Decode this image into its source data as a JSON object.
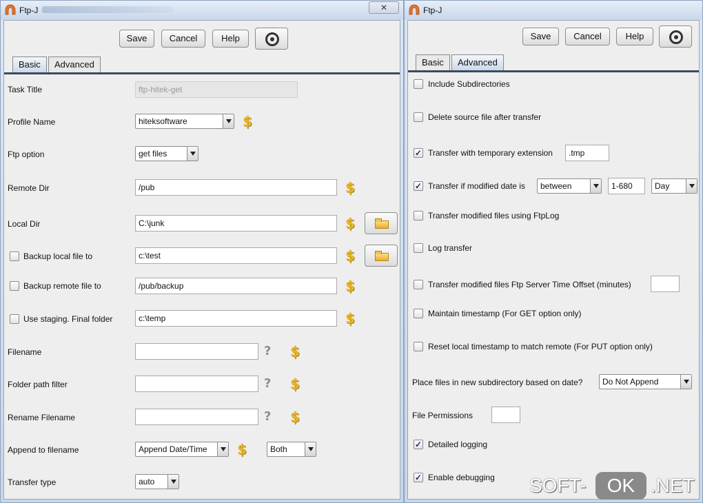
{
  "left_window": {
    "title": "Ftp-J",
    "close_glyph": "✕",
    "toolbar": {
      "save": "Save",
      "cancel": "Cancel",
      "help": "Help"
    },
    "tabs": {
      "basic": "Basic",
      "advanced": "Advanced",
      "active": "Basic"
    },
    "fields": {
      "task_title": {
        "label": "Task Title",
        "value": "ftp-hitek-get"
      },
      "profile_name": {
        "label": "Profile Name",
        "value": "hiteksoftware"
      },
      "ftp_option": {
        "label": "Ftp option",
        "value": "get files"
      },
      "remote_dir": {
        "label": "Remote Dir",
        "value": "/pub"
      },
      "local_dir": {
        "label": "Local Dir",
        "value": "C:\\junk"
      },
      "backup_local": {
        "label": "Backup local file to",
        "value": "c:\\test",
        "checked": false
      },
      "backup_remote": {
        "label": "Backup remote file to",
        "value": "/pub/backup",
        "checked": false
      },
      "staging": {
        "label": "Use staging.  Final folder",
        "value": "c:\\temp",
        "checked": false
      },
      "filename": {
        "label": "Filename",
        "value": ""
      },
      "folder_path_filter": {
        "label": "Folder path filter",
        "value": ""
      },
      "rename_filename": {
        "label": "Rename Filename",
        "value": ""
      },
      "append_to_filename": {
        "label": "Append to filename",
        "value": "Append Date/Time",
        "value2": "Both"
      },
      "transfer_type": {
        "label": "Transfer type",
        "value": "auto"
      }
    },
    "dollar": "$",
    "question": "?"
  },
  "right_window": {
    "title": "Ftp-J",
    "toolbar": {
      "save": "Save",
      "cancel": "Cancel",
      "help": "Help"
    },
    "tabs": {
      "basic": "Basic",
      "advanced": "Advanced",
      "active": "Advanced"
    },
    "options": {
      "include_subdirs": {
        "label": "Include Subdirectories",
        "checked": false
      },
      "delete_source": {
        "label": "Delete source file after transfer",
        "checked": false
      },
      "temp_extension": {
        "label": "Transfer with temporary extension",
        "checked": true,
        "value": ".tmp"
      },
      "modified_date": {
        "label": "Transfer if modified date is",
        "checked": true,
        "operator": "between",
        "range": "1-680",
        "unit": "Day"
      },
      "modified_ftplog": {
        "label": "Transfer modified files using FtpLog",
        "checked": false
      },
      "log_transfer": {
        "label": "Log transfer",
        "checked": false
      },
      "server_offset": {
        "label": "Transfer modified files  Ftp Server Time Offset (minutes)",
        "checked": false,
        "value": ""
      },
      "maintain_timestamp": {
        "label": "Maintain timestamp (For GET option only)",
        "checked": false
      },
      "reset_timestamp": {
        "label": "Reset local timestamp to match remote (For PUT option only)",
        "checked": false
      },
      "place_subdir": {
        "label": "Place files in new subdirectory based on date?",
        "value": "Do Not Append"
      },
      "file_permissions": {
        "label": "File Permissions",
        "value": ""
      },
      "detailed_logging": {
        "label": "Detailed logging",
        "checked": true
      },
      "enable_debugging": {
        "label": "Enable debugging",
        "checked": true
      }
    }
  },
  "watermark": {
    "part1": "SOFT-",
    "part2": "OK",
    "part3": ".NET"
  },
  "colors": {
    "accent_dollar": "#e7b62d",
    "tab_underline": "#3b4a5e",
    "panel_bg": "#eeeeee"
  },
  "check_glyph": "✓"
}
